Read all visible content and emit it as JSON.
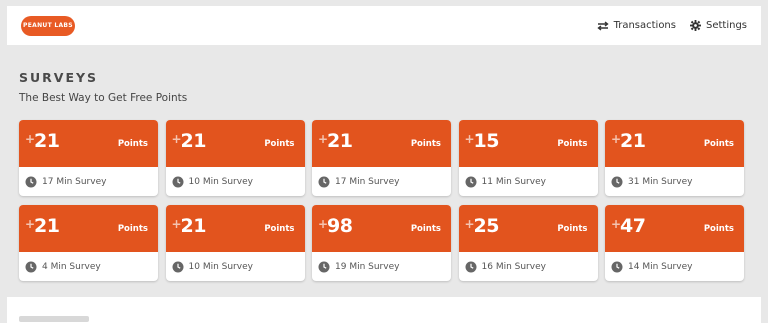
{
  "header": {
    "logo_text": "PEANUT LABS",
    "nav": [
      {
        "label": "Transactions",
        "icon": "transfer-arrows-icon"
      },
      {
        "label": "Settings",
        "icon": "gear-icon"
      }
    ]
  },
  "section": {
    "title": "SURVEYS",
    "subtitle": "The Best Way to Get Free Points"
  },
  "cards": [
    {
      "plus": "+",
      "points": "21",
      "points_label": "Points",
      "duration": "17 Min Survey"
    },
    {
      "plus": "+",
      "points": "21",
      "points_label": "Points",
      "duration": "10 Min Survey"
    },
    {
      "plus": "+",
      "points": "21",
      "points_label": "Points",
      "duration": "17 Min Survey"
    },
    {
      "plus": "+",
      "points": "15",
      "points_label": "Points",
      "duration": "11 Min Survey"
    },
    {
      "plus": "+",
      "points": "21",
      "points_label": "Points",
      "duration": "31 Min Survey"
    },
    {
      "plus": "+",
      "points": "21",
      "points_label": "Points",
      "duration": "4 Min Survey"
    },
    {
      "plus": "+",
      "points": "21",
      "points_label": "Points",
      "duration": "10 Min Survey"
    },
    {
      "plus": "+",
      "points": "98",
      "points_label": "Points",
      "duration": "19 Min Survey"
    },
    {
      "plus": "+",
      "points": "25",
      "points_label": "Points",
      "duration": "16 Min Survey"
    },
    {
      "plus": "+",
      "points": "47",
      "points_label": "Points",
      "duration": "14 Min Survey"
    }
  ],
  "colors": {
    "brand": "#e85a24",
    "card_top": "#e2541e",
    "background": "#e8e8e8"
  }
}
